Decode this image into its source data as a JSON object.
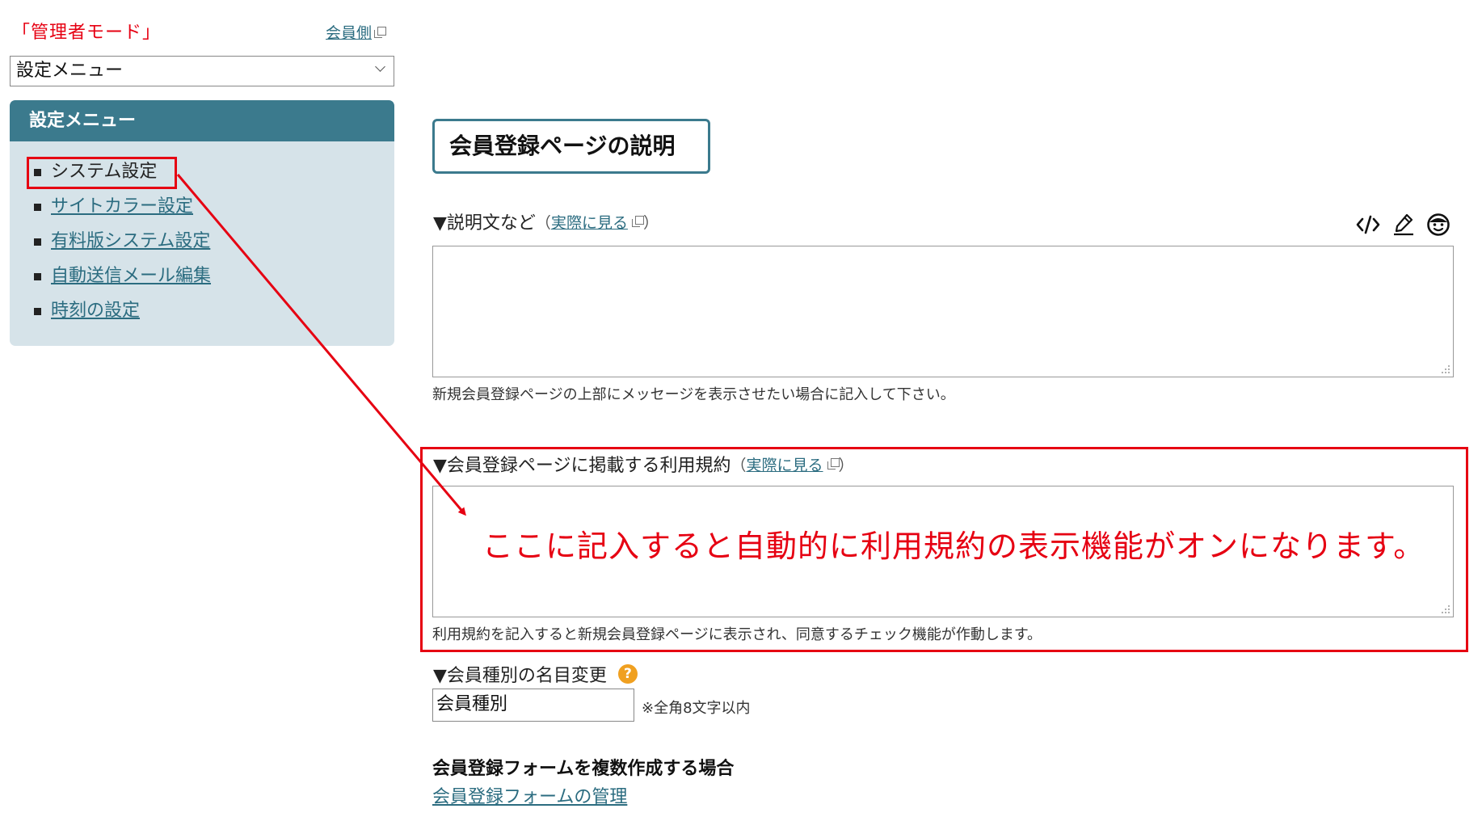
{
  "sidebar": {
    "admin_mode": "「管理者モード」",
    "member_link": "会員側",
    "select_value": "設定メニュー",
    "menu_title": "設定メニュー",
    "items": [
      {
        "label": "システム設定",
        "current": true
      },
      {
        "label": "サイトカラー設定",
        "current": false
      },
      {
        "label": "有料版システム設定",
        "current": false
      },
      {
        "label": "自動送信メール編集",
        "current": false
      },
      {
        "label": "時刻の設定",
        "current": false
      }
    ]
  },
  "main": {
    "title": "会員登録ページの説明",
    "description_section": {
      "label": "▼説明文など",
      "open_paren": "（",
      "view_link": "実際に見る",
      "close_paren": "）",
      "hint": "新規会員登録ページの上部にメッセージを表示させたい場合に記入して下さい。"
    },
    "toolbar": [
      "code-icon",
      "pen-icon",
      "smiley-icon"
    ],
    "terms_section": {
      "label": "▼会員登録ページに掲載する利用規約",
      "open_paren": "（",
      "view_link": "実際に見る",
      "close_paren": "）",
      "hint": "利用規約を記入すると新規会員登録ページに表示され、同意するチェック機能が作動します。"
    },
    "annotation": "ここに記入すると自動的に利用規約の表示機能がオンになります。",
    "member_type": {
      "label": "▼会員種別の名目変更",
      "help": "?",
      "input_value": "会員種別",
      "note": "※全角8文字以内"
    },
    "multi_form": {
      "heading": "会員登録フォームを複数作成する場合",
      "link": "会員登録フォームの管理"
    }
  },
  "colors": {
    "accent": "#3b7a8d",
    "annotation_red": "#e60012",
    "link": "#2b6c80",
    "panel_bg": "#d6e3e9"
  }
}
